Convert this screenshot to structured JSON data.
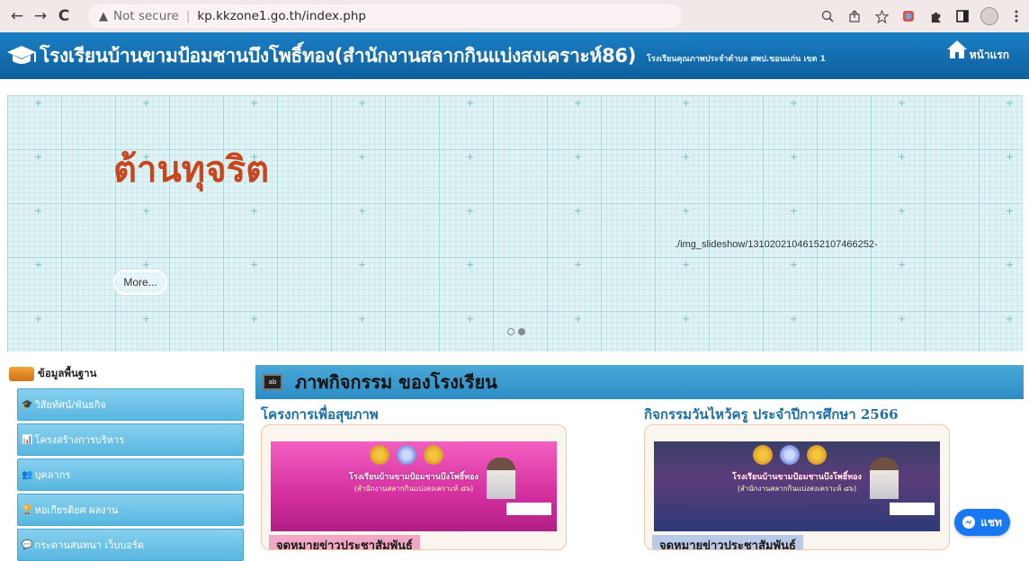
{
  "browser": {
    "back_icon": "←",
    "forward_icon": "→",
    "reload_icon": "C",
    "warning_icon": "▲",
    "security_label": "Not secure",
    "url": "kp.kkzone1.go.th/index.php"
  },
  "header": {
    "title": "โรงเรียนบ้านขามป้อมชานบึงโพธิ์ทอง(สำนักงานสลากกินแบ่งสงเคราะห์86)",
    "subtitle": "โรงเรียนคุณภาพประจำตำบล สพป.ขอนแก่น เขต 1",
    "home_label": "หน้าแรก"
  },
  "slideshow": {
    "title": "ต้านทุจริต",
    "image_path": "./img_slideshow/13102021046152107466252-",
    "more_label": "More...",
    "slide_count": 2,
    "active_slide": 2
  },
  "sidebar": {
    "heading": "ข้อมูลพื้นฐาน",
    "items": [
      {
        "label": "วิสัยทัศน์/พันธกิจ",
        "icon": "🎓"
      },
      {
        "label": "โครงสร้างการบริหาร",
        "icon": "📊"
      },
      {
        "label": "บุคลากร",
        "icon": "👥"
      },
      {
        "label": "หอเกียรติยศ ผลงาน",
        "icon": "🏆"
      },
      {
        "label": "กระดานสนทนา เว็บบอร์ด",
        "icon": "💬"
      }
    ]
  },
  "activity": {
    "heading": "ภาพกิจกรรม ของโรงเรียน",
    "news": [
      {
        "title": "โครงการเพื่อสุขภาพ",
        "banner_line1": "โรงเรียนบ้านขามป้อมชานบึงโพธิ์ทอง",
        "banner_line2": "(สำนักงานสลากกินแบ่งสงเคราะห์ ๘๖)",
        "headline": "จดหมายข่าวประชาสัมพันธ์"
      },
      {
        "title": "กิจกรรมวันไหว้ครู ประจำปีการศึกษา 2566",
        "banner_line1": "โรงเรียนบ้านขามป้อมชานบึงโพธิ์ทอง",
        "banner_line2": "(สำนักงานสลากกินแบ่งสงเคราะห์ ๘๖)",
        "headline": "จดหมายข่าวประชาสัมพันธ์"
      }
    ]
  },
  "chat": {
    "label": "แชท",
    "icon": "messenger-icon"
  },
  "colors": {
    "header_blue": "#1b7fc4",
    "slide_title": "#c8451e",
    "sidebar_item": "#58b6e0",
    "news_title": "#1a6ea8",
    "chat_blue": "#1877f2"
  }
}
